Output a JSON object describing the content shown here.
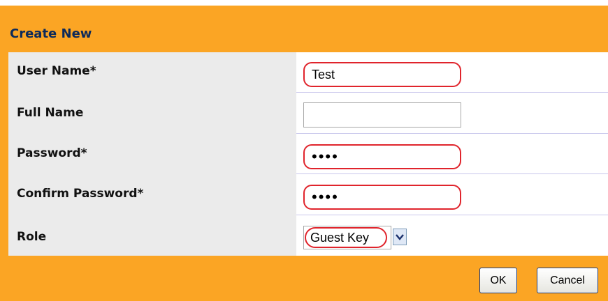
{
  "dialog": {
    "title": "Create New"
  },
  "form": {
    "fields": [
      {
        "label": "User Name*",
        "value": "Test",
        "required": true
      },
      {
        "label": "Full Name",
        "value": "",
        "required": false
      },
      {
        "label": "Password*",
        "value": "••••",
        "required": true
      },
      {
        "label": "Confirm Password*",
        "value": "••••",
        "required": true
      }
    ],
    "role": {
      "label": "Role",
      "selected": "Guest Key"
    }
  },
  "buttons": {
    "ok": "OK",
    "cancel": "Cancel"
  },
  "colors": {
    "header_bg": "#fba524",
    "title_text": "#0d2a5a",
    "label_column_bg": "#ebebeb",
    "error_outline": "#e0242c",
    "row_separator": "#c9c7ec"
  },
  "icons": {
    "select_arrow": "chevron-down-icon"
  }
}
